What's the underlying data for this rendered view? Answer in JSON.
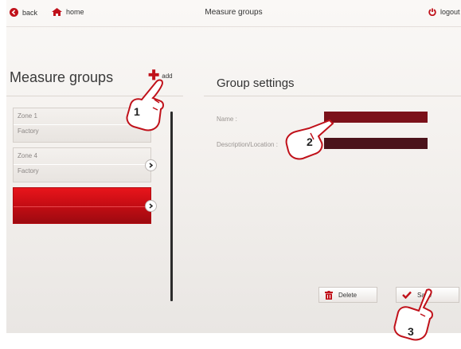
{
  "topbar": {
    "back_label": "back",
    "home_label": "home",
    "title": "Measure groups",
    "logout_label": "logout"
  },
  "left": {
    "title": "Measure groups",
    "add_label": "add",
    "groups": [
      {
        "zone": "Zone 1",
        "location": "Factory"
      },
      {
        "zone": "Zone 4",
        "location": "Factory"
      },
      {
        "zone": "",
        "location": ""
      }
    ]
  },
  "right": {
    "title": "Group settings",
    "name_label": "Name :",
    "name_value": "",
    "description_label": "Description/Location :",
    "description_value": "",
    "delete_label": "Delete",
    "save_label": "Save"
  },
  "callouts": [
    "1",
    "2",
    "3"
  ],
  "colors": {
    "accent": "#d0121a",
    "name_field": "#7b111a",
    "description_field": "#4b131b"
  },
  "icons": [
    "back-arrow-icon",
    "home-icon",
    "power-icon",
    "plus-icon",
    "chevron-right-icon",
    "trash-icon",
    "checkmark-icon",
    "hand-pointer-icon"
  ]
}
